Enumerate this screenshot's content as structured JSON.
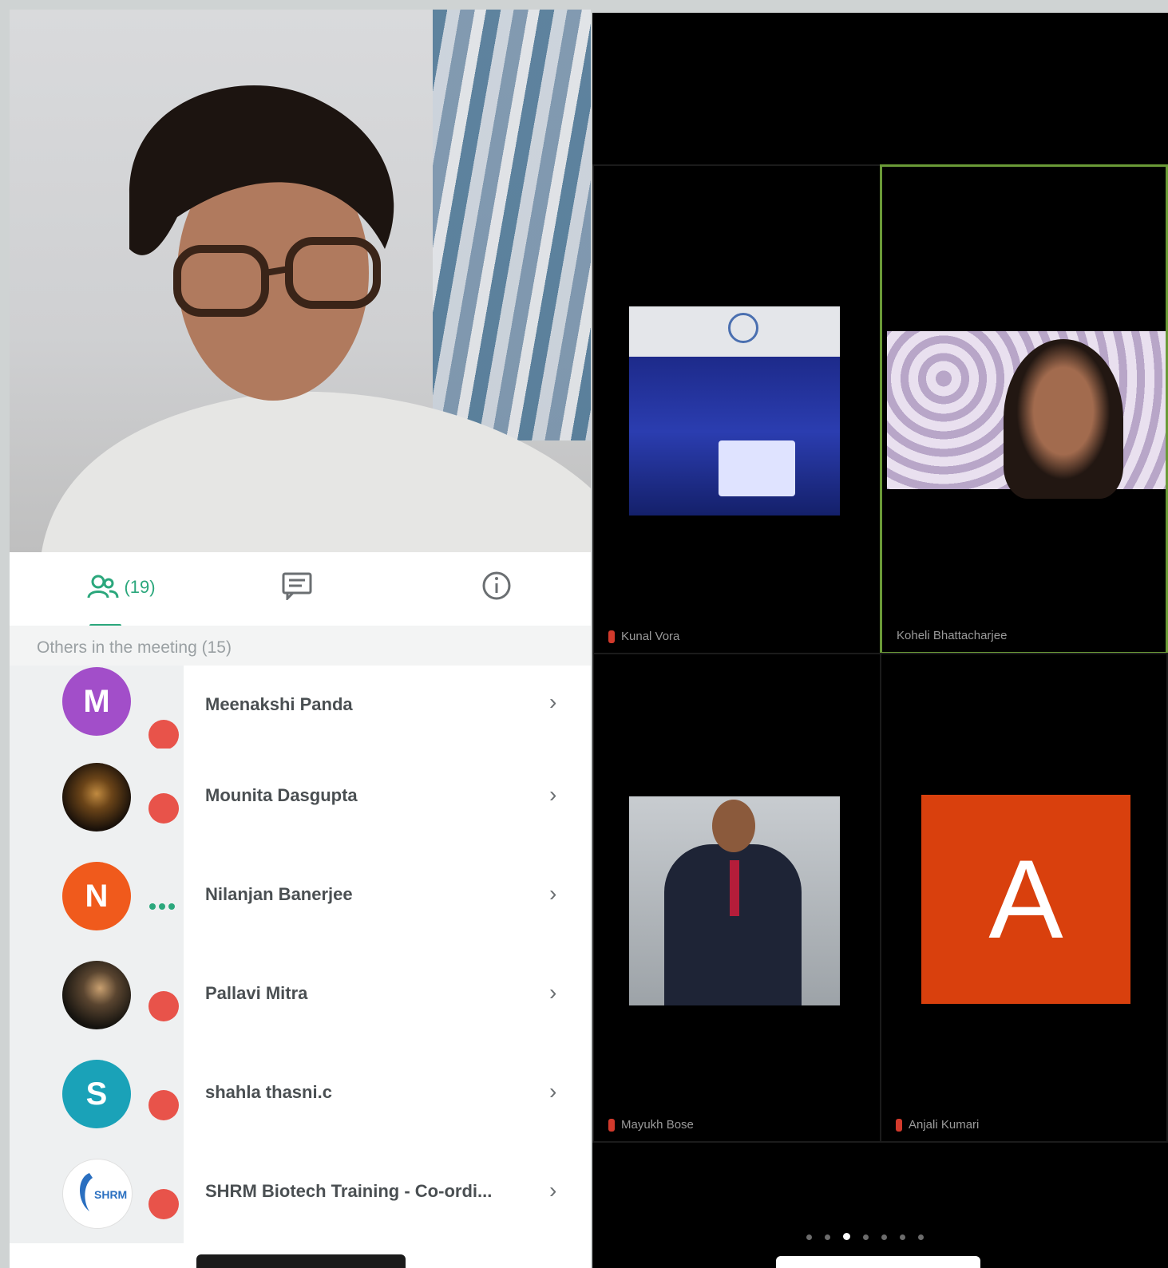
{
  "participants_panel": {
    "tabs": {
      "people_count": "(19)"
    },
    "section_header": "Others in the meeting (15)",
    "participants": [
      {
        "name": "Meenakshi Panda",
        "initial": "M",
        "avatar_color": "#a24ec9",
        "status": "muted"
      },
      {
        "name": "Mounita Dasgupta",
        "initial": "",
        "avatar_color": "#3a2a18",
        "status": "muted"
      },
      {
        "name": "Nilanjan Banerjee",
        "initial": "N",
        "avatar_color": "#f05a1c",
        "status": "speaking"
      },
      {
        "name": "Pallavi Mitra",
        "initial": "",
        "avatar_color": "#2b2b24",
        "status": "muted"
      },
      {
        "name": "shahla thasni.c",
        "initial": "S",
        "avatar_color": "#1aa2b8",
        "status": "muted"
      },
      {
        "name": "SHRM Biotech Training - Co-ordi...",
        "initial": "",
        "avatar_color": "#ffffff",
        "status": "muted"
      }
    ]
  },
  "video_grid": {
    "tiles": [
      {
        "name": "Kunal Vora",
        "muted": true,
        "active": false
      },
      {
        "name": "Koheli Bhattacharjee",
        "muted": false,
        "active": true
      },
      {
        "name": "Mayukh Bose",
        "muted": true,
        "active": false
      },
      {
        "name": "Anjali Kumari",
        "muted": true,
        "active": false,
        "avatar_letter": "A",
        "avatar_color": "#d9400d"
      }
    ],
    "page_count": 7,
    "current_page": 3
  },
  "colors": {
    "accent": "#2ba77c",
    "muted_badge": "#e8534a",
    "active_border": "#6a9a37"
  }
}
